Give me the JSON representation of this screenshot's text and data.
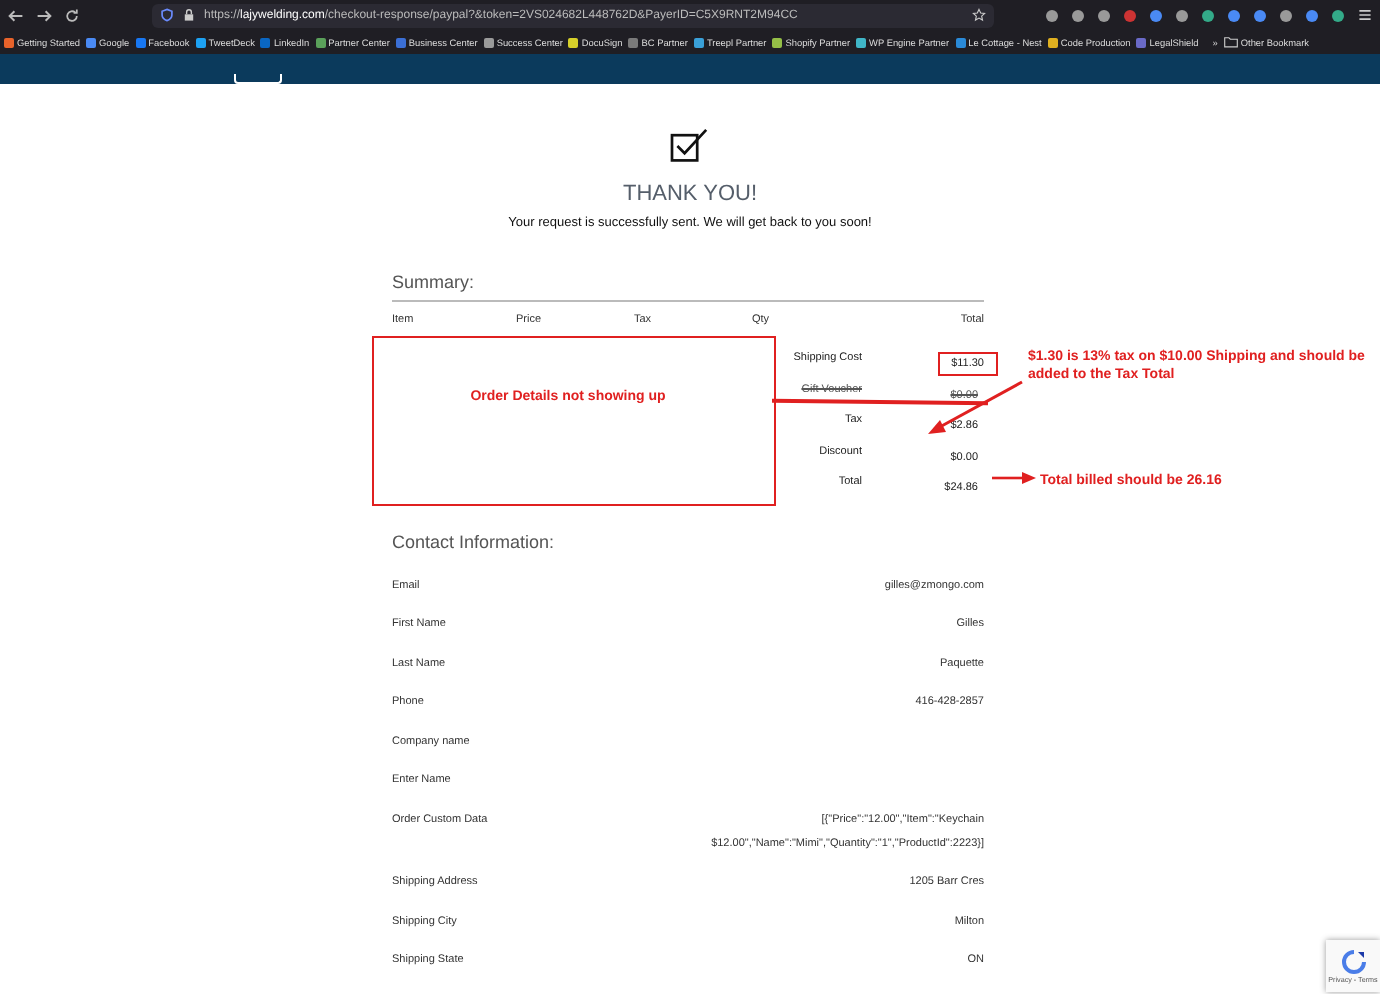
{
  "browser": {
    "url_prefix": "https://",
    "url_domain": "lajywelding.com",
    "url_path": "/checkout-response/paypal?&token=2VS024682L448762D&PayerID=C5X9RNT2M94CC",
    "bookmarks": [
      {
        "label": "Getting Started",
        "color": "#e8632b"
      },
      {
        "label": "Google",
        "color": "#4a8af4"
      },
      {
        "label": "Facebook",
        "color": "#1877f2"
      },
      {
        "label": "TweetDeck",
        "color": "#1da1f2"
      },
      {
        "label": "LinkedIn",
        "color": "#0a66c2"
      },
      {
        "label": "Partner Center",
        "color": "#5aa05a"
      },
      {
        "label": "Business Center",
        "color": "#3b6fd6"
      },
      {
        "label": "Success Center",
        "color": "#9a9a9a"
      },
      {
        "label": "DocuSign",
        "color": "#d6d02a"
      },
      {
        "label": "BC Partner",
        "color": "#7a7a7a"
      },
      {
        "label": "Treepl Partner",
        "color": "#3aa0d8"
      },
      {
        "label": "Shopify Partner",
        "color": "#95bf47"
      },
      {
        "label": "WP Engine Partner",
        "color": "#40b6c8"
      },
      {
        "label": "Le Cottage - Nest",
        "color": "#2a8ad8"
      },
      {
        "label": "Code Production",
        "color": "#e0b020"
      },
      {
        "label": "LegalShield",
        "color": "#6a6ac8"
      }
    ],
    "more": "»",
    "other_bookmarks": "Other Bookmark"
  },
  "confirmation": {
    "title": "THANK YOU!",
    "message": "Your request is successfully sent. We will get back to you soon!"
  },
  "summary": {
    "title": "Summary:",
    "columns": [
      "Item",
      "Price",
      "Tax",
      "Qty",
      "Total"
    ],
    "totals": [
      {
        "label": "Shipping Cost",
        "value": "$11.30",
        "highlighted": true,
        "struck_out": false
      },
      {
        "label": "Gift Voucher",
        "value": "$0.00",
        "highlighted": false,
        "struck_out": true
      },
      {
        "label": "Tax",
        "value": "$2.86",
        "highlighted": false,
        "struck_out": false
      },
      {
        "label": "Discount",
        "value": "$0.00",
        "highlighted": false,
        "struck_out": false
      },
      {
        "label": "Total",
        "value": "$24.86",
        "highlighted": false,
        "struck_out": false
      }
    ],
    "empty_box_note": "Order Details not showing up",
    "notes": [
      "$1.30 is 13% tax on $10.00 Shipping and should be added to the Tax Total",
      "Total billed should be 26.16"
    ]
  },
  "contact": {
    "title": "Contact Information:",
    "rows": [
      {
        "label": "Email",
        "values": [
          "gilles@zmongo.com"
        ]
      },
      {
        "label": "First Name",
        "values": [
          "Gilles"
        ]
      },
      {
        "label": "Last Name",
        "values": [
          "Paquette"
        ]
      },
      {
        "label": "Phone",
        "values": [
          "416-428-2857"
        ]
      },
      {
        "label": "Company name",
        "values": []
      },
      {
        "label": "Enter Name",
        "values": []
      },
      {
        "label": "Order Custom Data",
        "values": [
          "[{\"Price\":\"12.00\",\"Item\":\"Keychain",
          "$12.00\",\"Name\":\"Mimi\",\"Quantity\":\"1\",\"ProductId\":2223}]"
        ]
      },
      {
        "label": "Shipping Address",
        "values": [
          "1205 Barr Cres"
        ]
      },
      {
        "label": "Shipping City",
        "values": [
          "Milton"
        ]
      },
      {
        "label": "Shipping State",
        "values": [
          "ON"
        ]
      }
    ]
  },
  "recaptcha": {
    "links": "Privacy - Terms"
  }
}
